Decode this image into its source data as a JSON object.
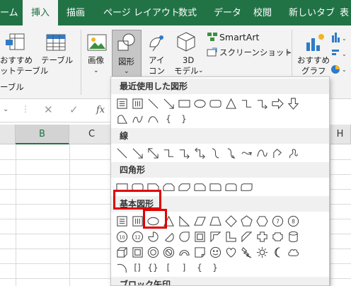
{
  "tabs": [
    {
      "label": "ーム"
    },
    {
      "label": "挿入"
    },
    {
      "label": "描画"
    },
    {
      "label": "ページ レイアウト"
    },
    {
      "label": "数式"
    },
    {
      "label": "データ"
    },
    {
      "label": "校閲"
    },
    {
      "label": "新しいタブ"
    },
    {
      "label": "表"
    }
  ],
  "ribbon": {
    "rec_table_line1": "おすすめ",
    "rec_table_line2": "ットテーブル",
    "table": "テーブル",
    "group_table": "ーブル",
    "image": "画像",
    "shapes": "図形",
    "icons_line1": "アイ",
    "icons_line2": "コン",
    "model3d_line1": "3D",
    "model3d_line2": "モデル",
    "smartart": "SmartArt",
    "screenshot": "スクリーンショット",
    "rec_chart_line1": "おすすめ",
    "rec_chart_line2": "グラフ"
  },
  "formula_bar": {
    "fx": "fx"
  },
  "grid": {
    "columns": [
      "B",
      "C",
      "H"
    ]
  },
  "shapes_menu": {
    "sections": {
      "recent": "最近使用した図形",
      "lines": "線",
      "rectangles": "四角形",
      "basic": "基本図形",
      "block_arrows": "ブロック矢印"
    },
    "brace_glyphs": {
      "open_brace": "{",
      "close_brace": "}",
      "open_bracket": "[",
      "close_bracket": "]"
    },
    "number_glyphs": {
      "ten": "10",
      "twelve": "12",
      "six": "6",
      "seven": "7",
      "eight": "8"
    }
  },
  "colors": {
    "excel_green": "#217346",
    "highlight_red": "#e00000"
  }
}
